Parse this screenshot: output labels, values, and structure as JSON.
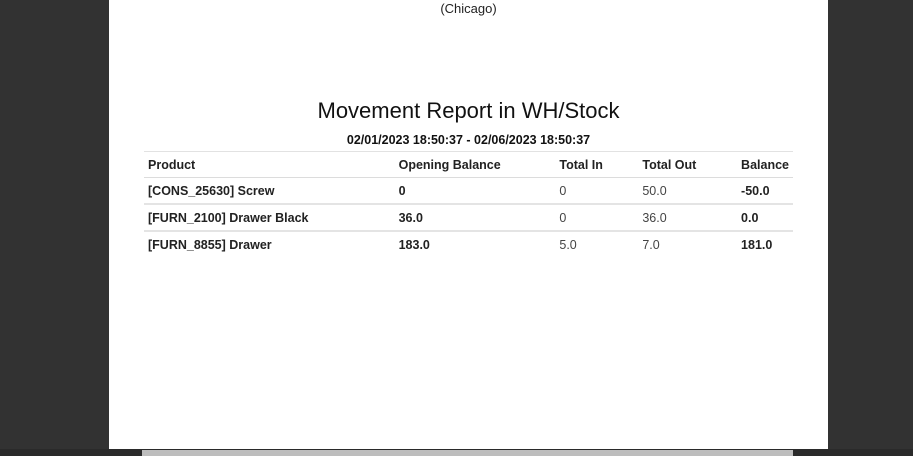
{
  "company": {
    "city_line": "(Chicago)"
  },
  "report": {
    "title": "Movement Report in WH/Stock",
    "date_range": "02/01/2023 18:50:37 - 02/06/2023 18:50:37",
    "columns": [
      "Product",
      "Opening Balance",
      "Total In",
      "Total Out",
      "Balance"
    ],
    "rows": [
      {
        "product": "[CONS_25630] Screw",
        "opening": "0",
        "total_in": "0",
        "total_out": "50.0",
        "balance": "-50.0"
      },
      {
        "product": "[FURN_2100] Drawer Black",
        "opening": "36.0",
        "total_in": "0",
        "total_out": "36.0",
        "balance": "0.0"
      },
      {
        "product": "[FURN_8855] Drawer",
        "opening": "183.0",
        "total_in": "5.0",
        "total_out": "7.0",
        "balance": "181.0"
      }
    ]
  },
  "colors": {
    "viewer_background": "#323232",
    "page": "#ffffff",
    "scroll_thumb": "#bdbdbd"
  }
}
